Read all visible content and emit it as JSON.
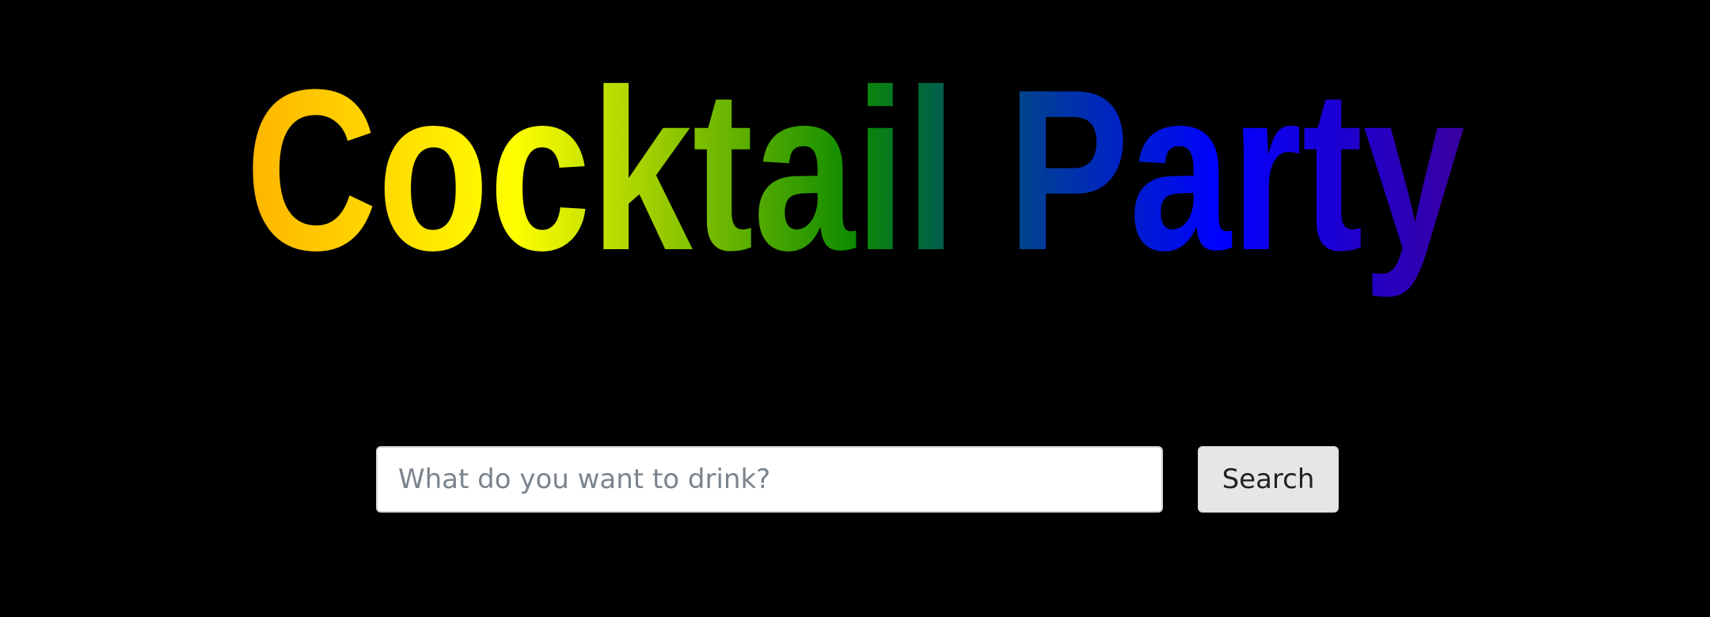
{
  "hero": {
    "title": "Cocktail Party"
  },
  "search": {
    "placeholder": "What do you want to drink?",
    "value": "",
    "button_label": "Search"
  },
  "colors": {
    "background": "#000000",
    "title_gradient": [
      "#ffb300",
      "#ffff00",
      "#3aa300",
      "#007a1f",
      "#005a60",
      "#003f99",
      "#0000ff",
      "#3a00a3"
    ]
  }
}
